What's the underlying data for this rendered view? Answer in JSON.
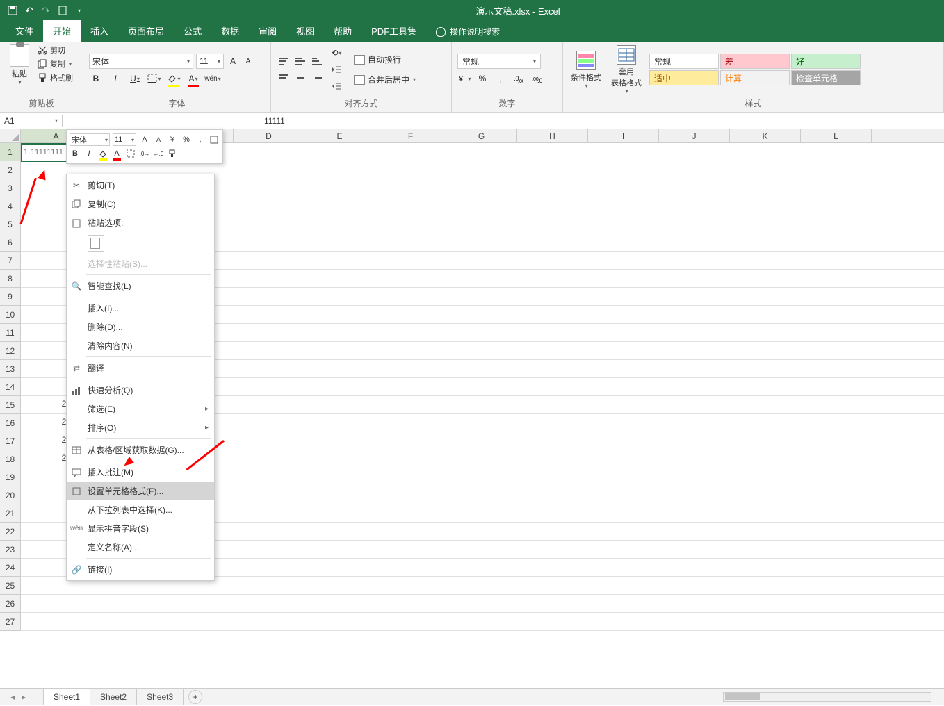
{
  "title": "演示文稿.xlsx - Excel",
  "tabs": {
    "file": "文件",
    "home": "开始",
    "insert": "插入",
    "layout": "页面布局",
    "formulas": "公式",
    "data": "数据",
    "review": "审阅",
    "view": "视图",
    "help": "帮助",
    "pdf": "PDF工具集",
    "tellme": "操作说明搜索"
  },
  "clipboard": {
    "paste": "粘贴",
    "cut": "剪切",
    "copy": "复制",
    "painter": "格式刷",
    "label": "剪贴板"
  },
  "font": {
    "name": "宋体",
    "size": "11",
    "bold": "B",
    "italic": "I",
    "underline": "U",
    "wen": "wén",
    "label": "字体"
  },
  "align": {
    "wrap": "自动换行",
    "merge": "合并后居中",
    "label": "对齐方式"
  },
  "number": {
    "format": "常规",
    "label": "数字"
  },
  "styles": {
    "cond": "条件格式",
    "table": "套用\n表格格式",
    "normal": "常规",
    "bad": "差",
    "good": "好",
    "neutral": "适中",
    "calc": "计算",
    "check": "检查单元格",
    "label": "样式"
  },
  "namebox": "A1",
  "formula_val": "11111",
  "cell_a1": "1.11111111",
  "mini": {
    "font": "宋体",
    "size": "11"
  },
  "ctx": {
    "cut": "剪切(T)",
    "copy": "复制(C)",
    "paste_opts": "粘贴选项:",
    "paste_special": "选择性粘贴(S)...",
    "smart": "智能查找(L)",
    "insert": "插入(I)...",
    "delete": "删除(D)...",
    "clear": "清除内容(N)",
    "translate": "翻译",
    "quick": "快速分析(Q)",
    "filter": "筛选(E)",
    "sort": "排序(O)",
    "getdata": "从表格/区域获取数据(G)...",
    "comment": "插入批注(M)",
    "format": "设置单元格格式(F)...",
    "dropdown": "从下拉列表中选择(K)...",
    "pinyin": "显示拼音字段(S)",
    "name": "定义名称(A)...",
    "link": "链接(I)"
  },
  "cols": [
    "A",
    "B",
    "C",
    "D",
    "E",
    "F",
    "G",
    "H",
    "I",
    "J",
    "K",
    "L"
  ],
  "row_nums": [
    "23",
    "24",
    "25",
    "26"
  ],
  "sheets": {
    "s1": "Sheet1",
    "s2": "Sheet2",
    "s3": "Sheet3"
  }
}
